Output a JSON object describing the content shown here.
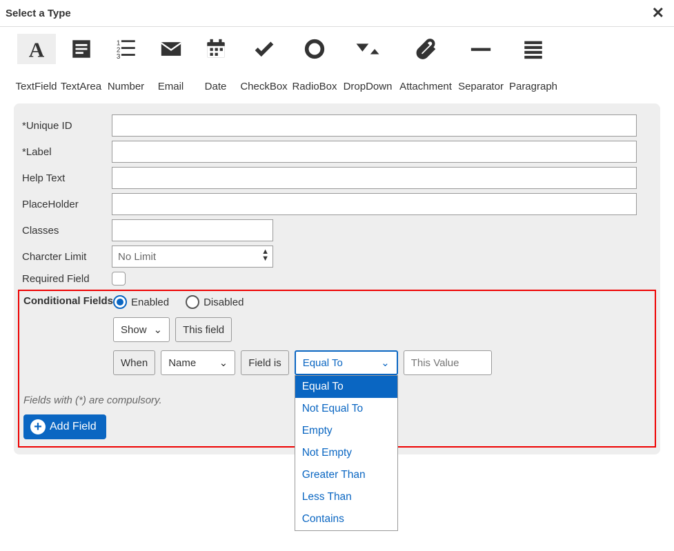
{
  "header": {
    "title": "Select a Type"
  },
  "types": [
    {
      "key": "textfield",
      "label": "TextField",
      "selected": true
    },
    {
      "key": "textarea",
      "label": "TextArea"
    },
    {
      "key": "number",
      "label": "Number"
    },
    {
      "key": "email",
      "label": "Email"
    },
    {
      "key": "date",
      "label": "Date"
    },
    {
      "key": "checkbox",
      "label": "CheckBox"
    },
    {
      "key": "radiobox",
      "label": "RadioBox"
    },
    {
      "key": "dropdown",
      "label": "DropDown"
    },
    {
      "key": "attachment",
      "label": "Attachment"
    },
    {
      "key": "separator",
      "label": "Separator"
    },
    {
      "key": "paragraph",
      "label": "Paragraph"
    }
  ],
  "form": {
    "unique_id": {
      "label": "*Unique ID",
      "value": ""
    },
    "label": {
      "label": "*Label",
      "value": ""
    },
    "help_text": {
      "label": "Help Text",
      "value": ""
    },
    "placeholder": {
      "label": "PlaceHolder",
      "value": ""
    },
    "classes": {
      "label": "Classes",
      "value": ""
    },
    "char_limit": {
      "label": "Charcter Limit",
      "value": "No Limit"
    },
    "required": {
      "label": "Required Field",
      "checked": false
    }
  },
  "conditional": {
    "label": "Conditional Fields",
    "enabled_label": "Enabled",
    "disabled_label": "Disabled",
    "enabled": true,
    "show_options": [
      "Show"
    ],
    "show_value": "Show",
    "this_field": "This field",
    "when": "When",
    "name_value": "Name",
    "field_is": "Field is",
    "operator_value": "Equal To",
    "operator_options": [
      "Equal To",
      "Not Equal To",
      "Empty",
      "Not Empty",
      "Greater Than",
      "Less Than",
      "Contains"
    ],
    "value_placeholder": "This Value"
  },
  "footer": {
    "compulsory_note": "Fields with (*) are compulsory.",
    "add_button": "Add Field"
  }
}
